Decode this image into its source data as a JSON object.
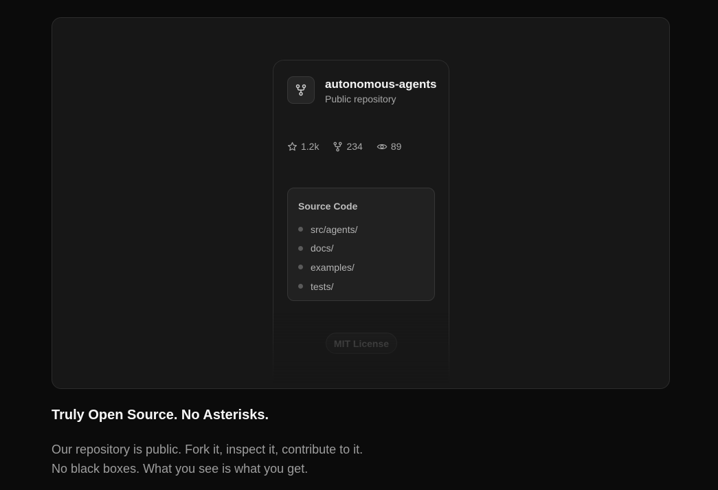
{
  "repo": {
    "name": "autonomous-agents",
    "visibility": "Public repository",
    "icon": "git-fork-icon",
    "stats": {
      "stars": "1.2k",
      "forks": "234",
      "watchers": "89"
    },
    "source": {
      "title": "Source Code",
      "files": [
        "src/agents/",
        "docs/",
        "examples/",
        "tests/"
      ]
    },
    "license": "MIT License"
  },
  "feature": {
    "heading": "Truly Open Source. No Asterisks.",
    "description": "Our repository is public. Fork it, inspect it, contribute to it. No black boxes. What you see is what you get."
  },
  "colors": {
    "background": "#0b0b0b",
    "panel": "#171717",
    "accent_text": "#f7f7f7"
  }
}
